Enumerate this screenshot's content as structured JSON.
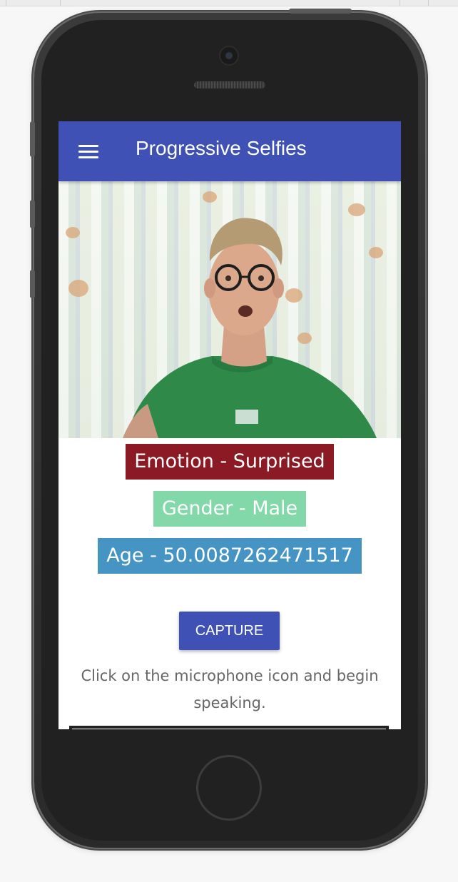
{
  "app": {
    "title": "Progressive Selfies"
  },
  "menu": {
    "icon": "hamburger-menu-icon"
  },
  "results": {
    "emotion": "Emotion - Surprised",
    "gender": "Gender - Male",
    "age": "Age - 50.0087262471517"
  },
  "actions": {
    "capture_label": "CAPTURE"
  },
  "hint": "Click on the microphone icon and begin speaking.",
  "colors": {
    "appbar": "#3f51b5",
    "emotion": "#8b1a25",
    "gender": "#82d8a8",
    "age": "#4594c3"
  }
}
